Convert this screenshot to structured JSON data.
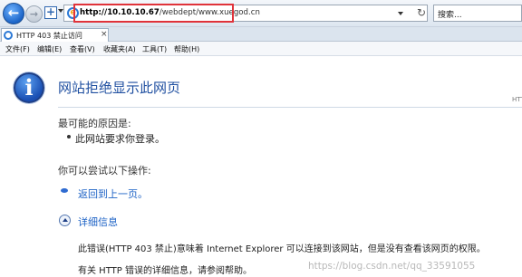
{
  "address_bar": {
    "url_host": "http://10.10.10.67",
    "url_path": "/webdept/www.xuegod.cn",
    "search_placeholder": "搜索...",
    "refresh_glyph": "↻",
    "search_glyph": "⌕"
  },
  "tab": {
    "title": "HTTP 403 禁止访问",
    "close_glyph": "×"
  },
  "menu": {
    "items": [
      "文件(F)",
      "编辑(E)",
      "查看(V)",
      "收藏夹(A)",
      "工具(T)",
      "帮助(H)"
    ]
  },
  "icons": {
    "back": "back-arrow-icon",
    "forward": "forward-arrow-icon",
    "info": "info-icon",
    "back_glyph": "←",
    "forward_glyph": "→",
    "info_glyph": "i",
    "new_tab_glyph": "+"
  },
  "content": {
    "title": "网站拒绝显示此网页",
    "corner_text": "HTT",
    "reasons_heading": "最可能的原因是:",
    "reasons": [
      "此网站要求你登录。"
    ],
    "try_heading": "你可以尝试以下操作:",
    "back_link": "返回到上一页。",
    "details_link": "详细信息",
    "detail_line1": "此错误(HTTP 403 禁止)意味着 Internet Explorer 可以连接到该网站，但是没有查看该网页的权限。",
    "detail_line2": "有关 HTTP 错误的详细信息，请参阅帮助。",
    "watermark": "https://blog.csdn.net/qq_33591055"
  },
  "colors": {
    "title_blue": "#1f4fa0",
    "link_blue": "#1e63c6",
    "highlight_red": "#e0333a"
  }
}
